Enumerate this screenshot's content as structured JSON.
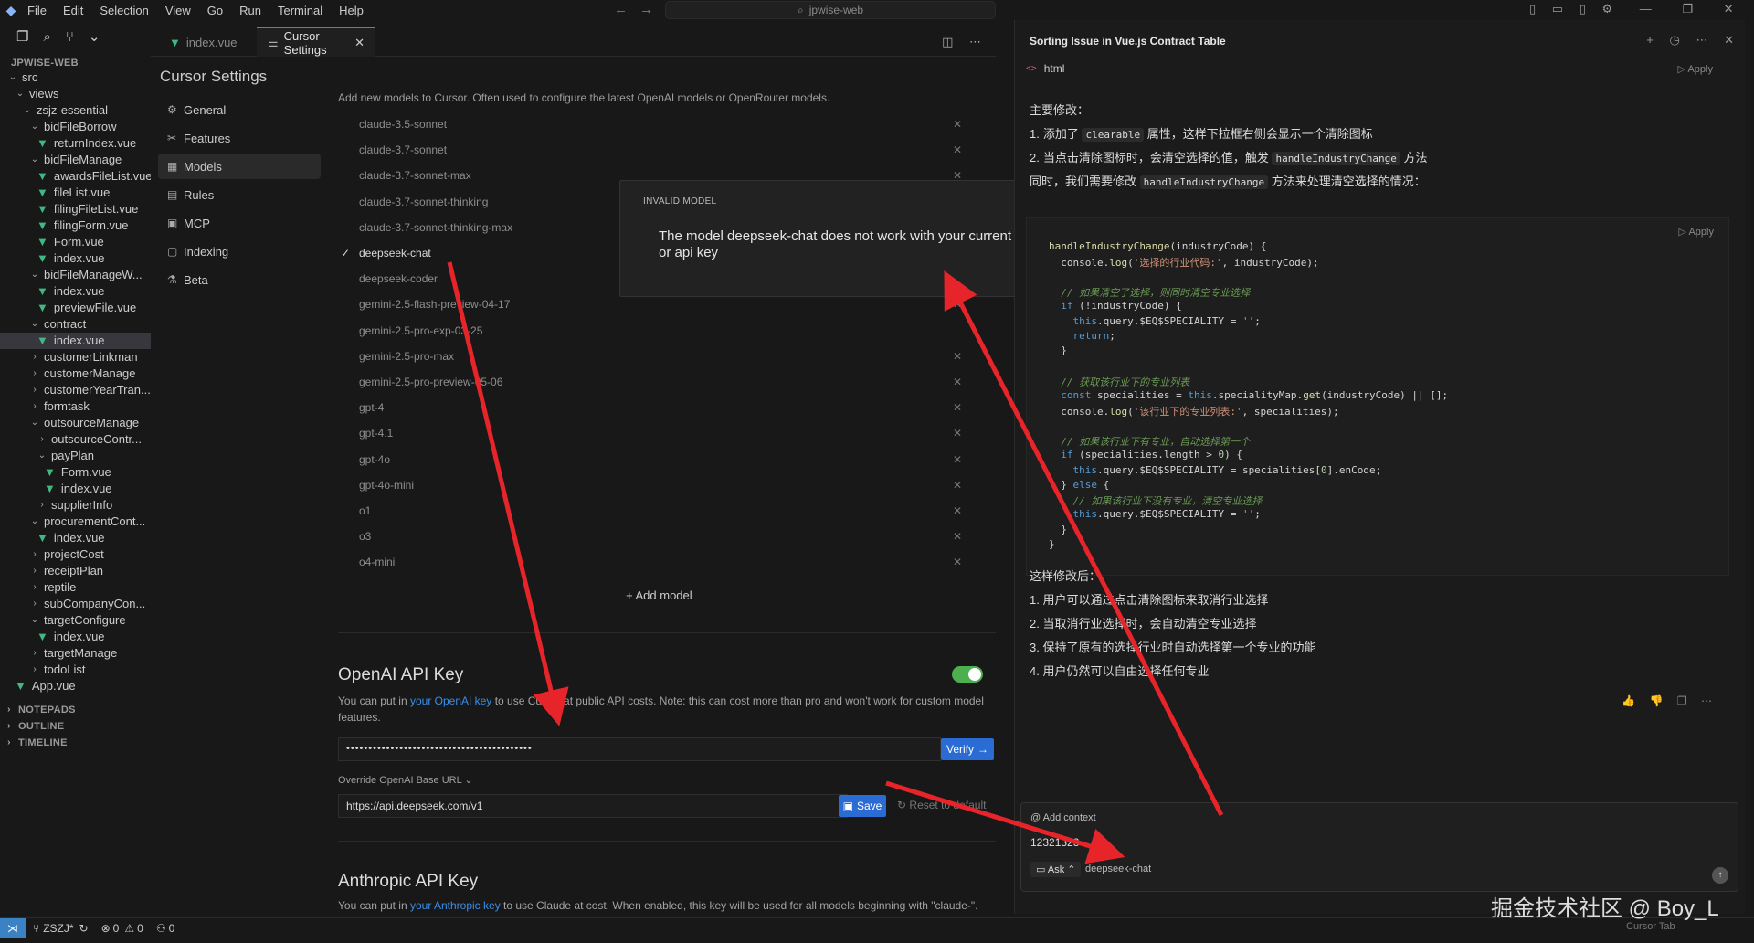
{
  "titlebar": {
    "menu": [
      "File",
      "Edit",
      "Selection",
      "View",
      "Go",
      "Run",
      "Terminal",
      "Help"
    ],
    "search": "jpwise-web"
  },
  "explorer": {
    "root": "JPWISE-WEB",
    "items": [
      {
        "label": "src",
        "depth": 0,
        "type": "folder",
        "open": true
      },
      {
        "label": "views",
        "depth": 1,
        "type": "folder",
        "open": true
      },
      {
        "label": "zsjz-essential",
        "depth": 2,
        "type": "folder",
        "open": true
      },
      {
        "label": "bidFileBorrow",
        "depth": 3,
        "type": "folder",
        "open": true
      },
      {
        "label": "returnIndex.vue",
        "depth": 4,
        "type": "vue"
      },
      {
        "label": "bidFileManage",
        "depth": 3,
        "type": "folder",
        "open": true
      },
      {
        "label": "awardsFileList.vue",
        "depth": 4,
        "type": "vue"
      },
      {
        "label": "fileList.vue",
        "depth": 4,
        "type": "vue"
      },
      {
        "label": "filingFileList.vue",
        "depth": 4,
        "type": "vue"
      },
      {
        "label": "filingForm.vue",
        "depth": 4,
        "type": "vue"
      },
      {
        "label": "Form.vue",
        "depth": 4,
        "type": "vue"
      },
      {
        "label": "index.vue",
        "depth": 4,
        "type": "vue"
      },
      {
        "label": "bidFileManageW...",
        "depth": 3,
        "type": "folder",
        "open": true
      },
      {
        "label": "index.vue",
        "depth": 4,
        "type": "vue"
      },
      {
        "label": "previewFile.vue",
        "depth": 4,
        "type": "vue"
      },
      {
        "label": "contract",
        "depth": 3,
        "type": "folder",
        "open": true
      },
      {
        "label": "index.vue",
        "depth": 4,
        "type": "vue",
        "selected": true
      },
      {
        "label": "customerLinkman",
        "depth": 3,
        "type": "folder"
      },
      {
        "label": "customerManage",
        "depth": 3,
        "type": "folder"
      },
      {
        "label": "customerYearTran...",
        "depth": 3,
        "type": "folder"
      },
      {
        "label": "formtask",
        "depth": 3,
        "type": "folder"
      },
      {
        "label": "outsourceManage",
        "depth": 3,
        "type": "folder",
        "open": true
      },
      {
        "label": "outsourceContr...",
        "depth": 4,
        "type": "folder"
      },
      {
        "label": "payPlan",
        "depth": 4,
        "type": "folder",
        "open": true
      },
      {
        "label": "Form.vue",
        "depth": 5,
        "type": "vue"
      },
      {
        "label": "index.vue",
        "depth": 5,
        "type": "vue"
      },
      {
        "label": "supplierInfo",
        "depth": 4,
        "type": "folder"
      },
      {
        "label": "procurementCont...",
        "depth": 3,
        "type": "folder",
        "open": true
      },
      {
        "label": "index.vue",
        "depth": 4,
        "type": "vue"
      },
      {
        "label": "projectCost",
        "depth": 3,
        "type": "folder"
      },
      {
        "label": "receiptPlan",
        "depth": 3,
        "type": "folder"
      },
      {
        "label": "reptile",
        "depth": 3,
        "type": "folder"
      },
      {
        "label": "subCompanyCon...",
        "depth": 3,
        "type": "folder"
      },
      {
        "label": "targetConfigure",
        "depth": 3,
        "type": "folder",
        "open": true
      },
      {
        "label": "index.vue",
        "depth": 4,
        "type": "vue"
      },
      {
        "label": "targetManage",
        "depth": 3,
        "type": "folder"
      },
      {
        "label": "todoList",
        "depth": 3,
        "type": "folder"
      },
      {
        "label": "App.vue",
        "depth": 1,
        "type": "vue"
      }
    ],
    "sections": [
      "NOTEPADS",
      "OUTLINE",
      "TIMELINE"
    ]
  },
  "tabs": [
    {
      "label": "index.vue",
      "type": "vue"
    },
    {
      "label": "Cursor Settings",
      "active": true
    }
  ],
  "settings": {
    "title": "Cursor Settings",
    "nav": [
      {
        "label": "General",
        "icon": "⚙"
      },
      {
        "label": "Features",
        "icon": "✂"
      },
      {
        "label": "Models",
        "icon": "▦",
        "selected": true
      },
      {
        "label": "Rules",
        "icon": "▤"
      },
      {
        "label": "MCP",
        "icon": "▣"
      },
      {
        "label": "Indexing",
        "icon": "▢"
      },
      {
        "label": "Beta",
        "icon": "⚗"
      }
    ],
    "models_desc": "Add new models to Cursor. Often used to configure the latest OpenAI models or OpenRouter models.",
    "models": [
      {
        "name": "claude-3.5-sonnet",
        "removable": true
      },
      {
        "name": "claude-3.7-sonnet",
        "removable": true
      },
      {
        "name": "claude-3.7-sonnet-max",
        "removable": true
      },
      {
        "name": "claude-3.7-sonnet-thinking",
        "removable": false
      },
      {
        "name": "claude-3.7-sonnet-thinking-max",
        "removable": false
      },
      {
        "name": "deepseek-chat",
        "removable": false,
        "checked": true
      },
      {
        "name": "deepseek-coder",
        "removable": false
      },
      {
        "name": "gemini-2.5-flash-preview-04-17",
        "removable": true
      },
      {
        "name": "gemini-2.5-pro-exp-03-25",
        "removable": false
      },
      {
        "name": "gemini-2.5-pro-max",
        "removable": true
      },
      {
        "name": "gemini-2.5-pro-preview-05-06",
        "removable": true
      },
      {
        "name": "gpt-4",
        "removable": true
      },
      {
        "name": "gpt-4.1",
        "removable": true
      },
      {
        "name": "gpt-4o",
        "removable": true
      },
      {
        "name": "gpt-4o-mini",
        "removable": true
      },
      {
        "name": "o1",
        "removable": true
      },
      {
        "name": "o3",
        "removable": true
      },
      {
        "name": "o4-mini",
        "removable": true
      }
    ],
    "add_model": "Add model",
    "openai": {
      "title": "OpenAI API Key",
      "desc_pre": "You can put in ",
      "desc_link": "your OpenAI key",
      "desc_post": " to use Cursor at public API costs. Note: this can cost more than pro and won't work for custom model features.",
      "key_value": "••••••••••••••••••••••••••••••••••••••••••",
      "verify": "Verify",
      "enabled": true,
      "override_label": "Override OpenAI Base URL",
      "base_url": "https://api.deepseek.com/v1",
      "save": "Save",
      "reset": "Reset to default"
    },
    "anthropic": {
      "title": "Anthropic API Key",
      "desc_pre": "You can put in ",
      "desc_link": "your Anthropic key",
      "desc_post": " to use Claude at cost. When enabled, this key will be used for all models beginning with \"claude-\"."
    }
  },
  "modal": {
    "title": "INVALID MODEL",
    "body": "The model deepseek-chat does not work with your current plan or api key"
  },
  "chat": {
    "title": "Sorting Issue in Vue.js Contract Table",
    "code_lang": "html",
    "apply": "Apply",
    "main_changes": "主要修改：",
    "changes": [
      {
        "n": "1.",
        "pre": "添加了 ",
        "code": "clearable",
        "post": " 属性，这样下拉框右侧会显示一个清除图标"
      },
      {
        "n": "2.",
        "pre": "当点击清除图标时，会清空选择的值，触发 ",
        "code": "handleIndustryChange",
        "post": " 方法"
      }
    ],
    "also": "同时，我们需要修改 ",
    "also_code": "handleIndustryChange",
    "also_post": " 方法来处理清空选择的情况：",
    "code_lines": [
      "handleIndustryChange(industryCode) {",
      "  console.log('选择的行业代码:', industryCode);",
      "",
      "  // 如果清空了选择，则同时清空专业选择",
      "  if (!industryCode) {",
      "    this.query.$EQ$SPECIALITY = '';",
      "    return;",
      "  }",
      "",
      "  // 获取该行业下的专业列表",
      "  const specialities = this.specialityMap.get(industryCode) || [];",
      "  console.log('该行业下的专业列表:', specialities);",
      "",
      "  // 如果该行业下有专业，自动选择第一个",
      "  if (specialities.length > 0) {",
      "    this.query.$EQ$SPECIALITY = specialities[0].enCode;",
      "  } else {",
      "    // 如果该行业下没有专业，清空专业选择",
      "    this.query.$EQ$SPECIALITY = '';",
      "  }",
      "}"
    ],
    "after_title": "这样修改后：",
    "after": [
      "1. 用户可以通过点击清除图标来取消行业选择",
      "2. 当取消行业选择时，会自动清空专业选择",
      "3. 保持了原有的选择行业时自动选择第一个专业的功能",
      "4. 用户仍然可以自由选择任何专业"
    ],
    "input": {
      "add_context": "Add context",
      "value": "12321323",
      "mode": "Ask",
      "model": "deepseek-chat"
    }
  },
  "statusbar": {
    "branch": "ZSZJ*",
    "errors": "0",
    "warnings": "0",
    "ports": "0",
    "right": "Cursor Tab"
  },
  "watermark": "掘金技术社区 @ Boy_L",
  "colors": {
    "accent": "#3b82f6",
    "arrow": "#e8242b",
    "vue": "#41b883",
    "toggle_on": "#4caf50"
  }
}
